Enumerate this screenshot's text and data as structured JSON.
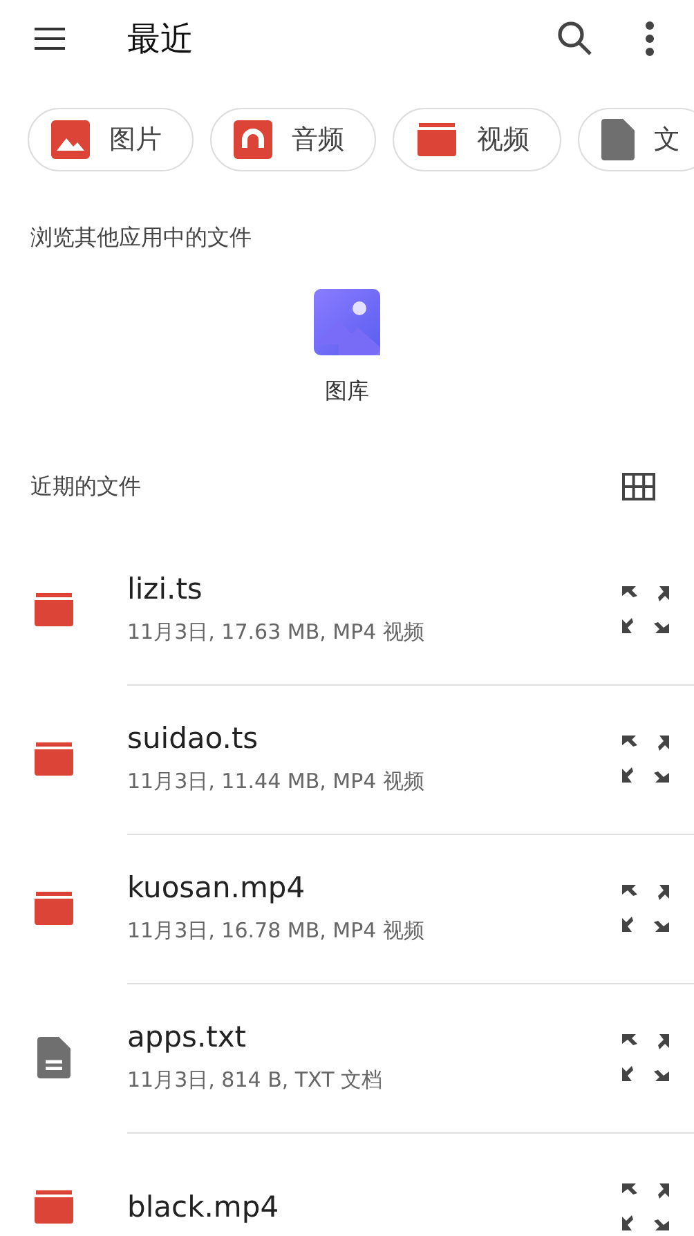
{
  "app_bar": {
    "title": "最近"
  },
  "chips": [
    {
      "kind": "image",
      "label": "图片"
    },
    {
      "kind": "audio",
      "label": "音频"
    },
    {
      "kind": "video",
      "label": "视频"
    },
    {
      "kind": "document",
      "label": "文"
    }
  ],
  "browse": {
    "heading": "浏览其他应用中的文件",
    "apps": [
      {
        "label": "图库"
      }
    ]
  },
  "recent": {
    "heading": "近期的文件"
  },
  "files": [
    {
      "kind": "video",
      "name": "lizi.ts",
      "meta": "11月3日, 17.63 MB, MP4 视频"
    },
    {
      "kind": "video",
      "name": "suidao.ts",
      "meta": "11月3日, 11.44 MB, MP4 视频"
    },
    {
      "kind": "video",
      "name": "kuosan.mp4",
      "meta": "11月3日, 16.78 MB, MP4 视频"
    },
    {
      "kind": "document",
      "name": "apps.txt",
      "meta": "11月3日, 814 B, TXT 文档"
    },
    {
      "kind": "video",
      "name": "black.mp4"
    }
  ]
}
